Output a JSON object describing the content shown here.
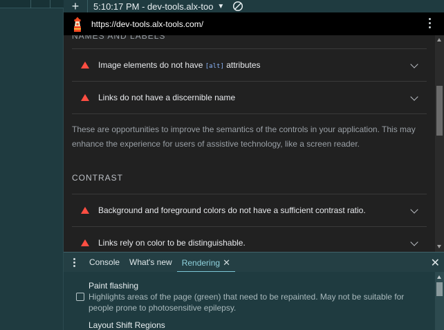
{
  "toolbar": {
    "new_tab_label": "+",
    "title": "5:10:17 PM - dev-tools.alx-too",
    "caret": "▼",
    "blocked_icon": "no-entry-icon"
  },
  "urlbar": {
    "url": "https://dev-tools.alx-tools.com/",
    "logo_icon": "lighthouse-icon",
    "menu_icon": "kebab-icon"
  },
  "report": {
    "cut_heading": "NAMES AND LABELS",
    "audits_names": [
      {
        "label_before": "Image elements do not have ",
        "code": "[alt]",
        "label_after": " attributes"
      },
      {
        "label": "Links do not have a discernible name"
      }
    ],
    "description": "These are opportunities to improve the semantics of the controls in your application. This may enhance the experience for users of assistive technology, like a screen reader.",
    "contrast_heading": "CONTRAST",
    "audits_contrast": [
      {
        "label": "Background and foreground colors do not have a sufficient contrast ratio."
      },
      {
        "label": "Links rely on color to be distinguishable."
      }
    ],
    "fail_color": "#ff4e42"
  },
  "drawer": {
    "tabs": [
      {
        "label": "Console",
        "active": false
      },
      {
        "label": "What's new",
        "active": false
      },
      {
        "label": "Rendering",
        "active": true
      }
    ],
    "tab_close": "✕",
    "close": "✕",
    "options": [
      {
        "title": "Paint flashing",
        "description": "Highlights areas of the page (green) that need to be repainted. May not be suitable for people prone to photosensitive epilepsy.",
        "checked": false
      },
      {
        "title": "Layout Shift Regions"
      }
    ],
    "accent_color": "#7cc8d6"
  }
}
